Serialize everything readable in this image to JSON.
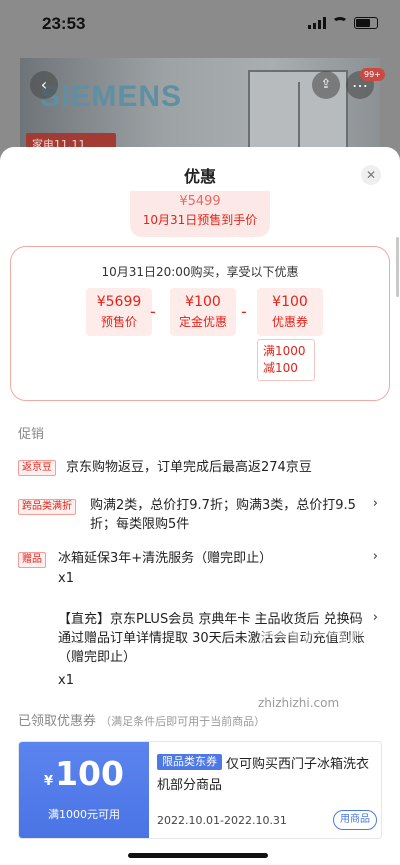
{
  "status_bar": {
    "time": "23:53"
  },
  "background": {
    "brand": "SIEMENS",
    "tag": "家电11.11",
    "badge": "99+"
  },
  "sheet": {
    "title": "优惠",
    "final_price": {
      "amount": "¥5499",
      "label": "10月31日预售到手价"
    },
    "calc": {
      "header": "10月31日20:00购买，享受以下优惠",
      "items": [
        {
          "value": "¥5699",
          "label": "预售价"
        },
        {
          "value": "¥100",
          "label": "定金优惠"
        },
        {
          "value": "¥100",
          "label": "优惠券"
        }
      ],
      "operators": [
        "-",
        "-"
      ],
      "coupon_condition": [
        "满1000",
        "减100"
      ]
    },
    "promotions": {
      "label": "促销",
      "items": [
        {
          "tag": "返京豆",
          "text": "京东购物返豆，订单完成后最高返274京豆"
        },
        {
          "tag": "跨品类满折",
          "text": "购满2类，总价打9.7折；购满3类，总价打9.5折；每类限购5件"
        },
        {
          "tag": "赠品",
          "text": "冰箱延保3年+清洗服务（赠完即止）",
          "qty": "x1"
        },
        {
          "tag": "",
          "text": "【直充】京东PLUS会员 京典年卡 主品收货后 兑换码通过赠品订单详情提取 30天后未激活会自动充值到账（赠完即止）",
          "qty": "x1"
        }
      ]
    },
    "coupons": {
      "label": "已领取优惠券",
      "note": "（满足条件后即可用于当前商品）",
      "card": {
        "currency": "¥",
        "amount": "100",
        "min": "满1000元可用",
        "type": "限品类东券",
        "desc": "仅可购买西门子冰箱洗衣机部分商品",
        "date": "2022.10.01-2022.10.31",
        "action": "用商品"
      }
    }
  },
  "watermark": {
    "text": "zhizhizhi.com"
  },
  "colors": {
    "accent": "#e2231a",
    "coupon_blue": "#4d78e6",
    "light_red": "#fdecea"
  }
}
